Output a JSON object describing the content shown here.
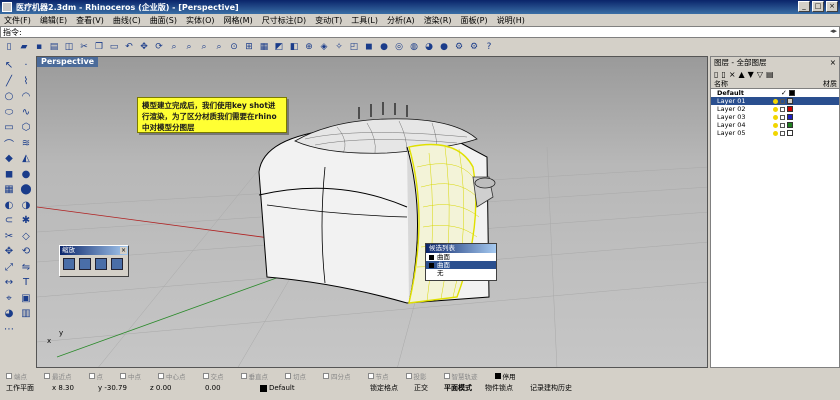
{
  "window": {
    "title": "医疗机器2.3dm - Rhinoceros (企业版) - [Perspective]",
    "buttons": {
      "minimize": "_",
      "maximize": "□",
      "close": "×"
    }
  },
  "menu": [
    "文件(F)",
    "编辑(E)",
    "查看(V)",
    "曲线(C)",
    "曲面(S)",
    "实体(O)",
    "网格(M)",
    "尺寸标注(D)",
    "变动(T)",
    "工具(L)",
    "分析(A)",
    "渲染(R)",
    "面板(P)",
    "说明(H)"
  ],
  "command": {
    "label": "指令:",
    "value": ""
  },
  "viewport": {
    "tab": "Perspective"
  },
  "note": {
    "text": "模型建立完成后，我们使用key shot进行渲染，为了区分材质我们需要在rhino中对模型分图层"
  },
  "float_panel": {
    "title": "缩放",
    "close": "×"
  },
  "popup": {
    "title": "候选列表",
    "items": [
      {
        "label": "曲面",
        "selected": false
      },
      {
        "label": "曲面",
        "selected": true
      },
      {
        "label": "无",
        "selected": false
      }
    ]
  },
  "axes": {
    "x": "x",
    "y": "y"
  },
  "layers_panel": {
    "title": "图层 - 全部图层",
    "columns": {
      "name": "名称",
      "material": "材质"
    },
    "rows": [
      {
        "name": "Default",
        "color": "#000000",
        "selected": false,
        "current": true
      },
      {
        "name": "Layer 01",
        "color": "#d4d0c8",
        "selected": true,
        "current": false
      },
      {
        "name": "Layer 02",
        "color": "#cc0000",
        "selected": false,
        "current": false
      },
      {
        "name": "Layer 03",
        "color": "#2020c0",
        "selected": false,
        "current": false
      },
      {
        "name": "Layer 04",
        "color": "#208020",
        "selected": false,
        "current": false
      },
      {
        "name": "Layer 05",
        "color": "#ffffff",
        "selected": false,
        "current": false
      }
    ],
    "current_mark": "✓"
  },
  "snaps": [
    {
      "label": "端点",
      "active": false
    },
    {
      "label": "最近点",
      "active": false
    },
    {
      "label": "点",
      "active": false
    },
    {
      "label": "中点",
      "active": false
    },
    {
      "label": "中心点",
      "active": false
    },
    {
      "label": "交点",
      "active": false
    },
    {
      "label": "垂直点",
      "active": false
    },
    {
      "label": "切点",
      "active": false
    },
    {
      "label": "四分点",
      "active": false
    },
    {
      "label": "节点",
      "active": false
    },
    {
      "label": "投影",
      "active": false
    },
    {
      "label": "智慧轨迹",
      "active": false
    },
    {
      "label": "停用",
      "active": true
    }
  ],
  "status": {
    "cplane": "工作平面",
    "x": "x 8.30",
    "y": "y -30.79",
    "z": "z 0.00",
    "dist": "0.00",
    "layer": "Default",
    "grid_snap": "锁定格点",
    "ortho": "正交",
    "planar": "平面模式",
    "osnap": "物件锁点",
    "history": "记录建构历史"
  }
}
